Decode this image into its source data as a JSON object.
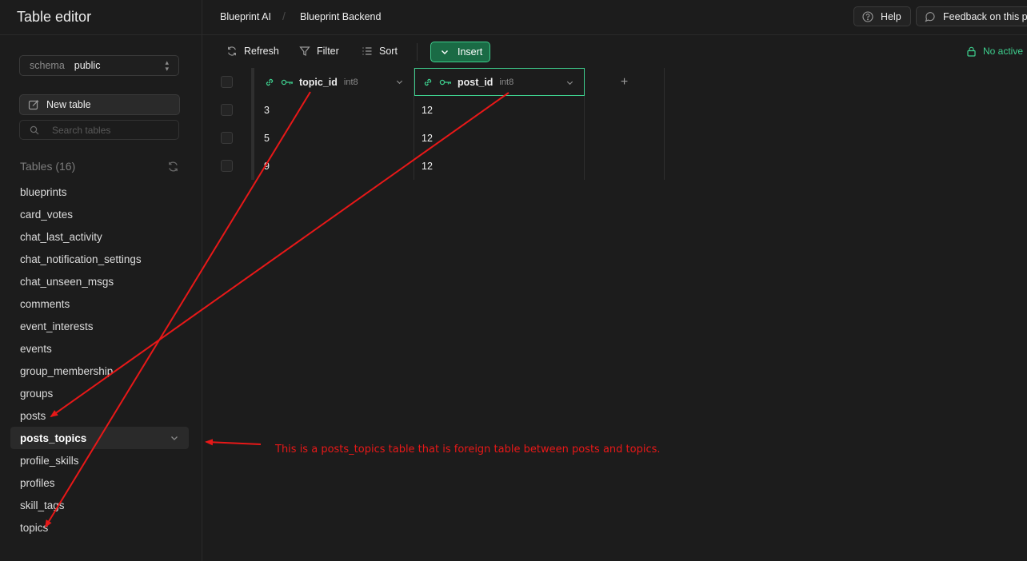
{
  "sidebar": {
    "title": "Table editor",
    "schema": {
      "label": "schema",
      "value": "public"
    },
    "new_table_label": "New table",
    "search_placeholder": "Search tables",
    "tables_heading": "Tables (16)",
    "tables": [
      "blueprints",
      "card_votes",
      "chat_last_activity",
      "chat_notification_settings",
      "chat_unseen_msgs",
      "comments",
      "event_interests",
      "events",
      "group_membership",
      "groups",
      "posts",
      "posts_topics",
      "profile_skills",
      "profiles",
      "skill_tags",
      "topics"
    ],
    "active_table": "posts_topics"
  },
  "topbar": {
    "breadcrumb": [
      "Blueprint AI",
      "Blueprint Backend"
    ],
    "separator": "/",
    "help_label": "Help",
    "feedback_label": "Feedback on this pa"
  },
  "toolbar": {
    "refresh_label": "Refresh",
    "filter_label": "Filter",
    "sort_label": "Sort",
    "insert_label": "Insert",
    "status_label": "No active"
  },
  "grid": {
    "columns": [
      {
        "name": "topic_id",
        "type": "int8"
      },
      {
        "name": "post_id",
        "type": "int8"
      }
    ],
    "add_column_label": "+",
    "rows": [
      [
        "3",
        "12"
      ],
      [
        "5",
        "12"
      ],
      [
        "9",
        "12"
      ]
    ]
  },
  "annotation": {
    "text": "This is a posts_topics table that is foreign table between posts and topics.",
    "color": "#e81818"
  },
  "colors": {
    "accent": "#3ecf8e",
    "insert_bg": "#1a6b45",
    "background": "#1c1c1c"
  }
}
